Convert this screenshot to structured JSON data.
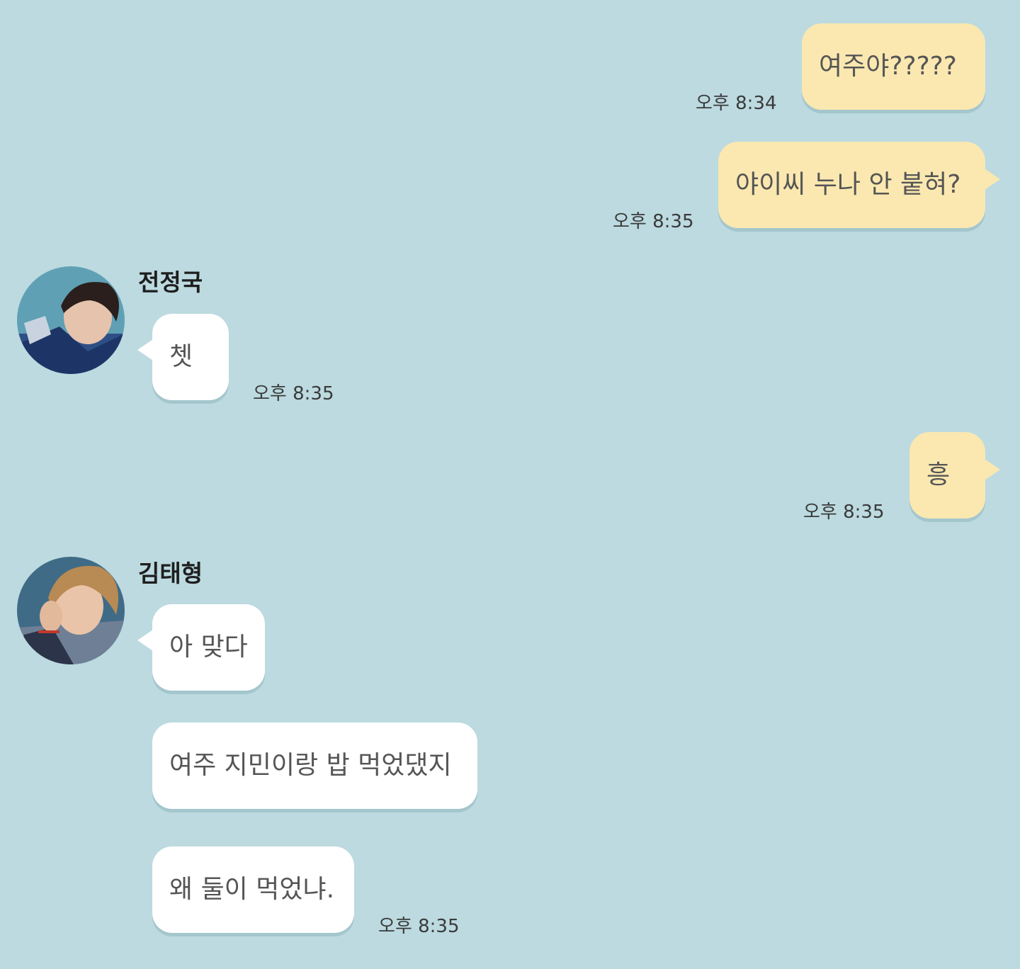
{
  "messages": {
    "m1": {
      "text": "여주야?????",
      "time": "오후 8:34"
    },
    "m2": {
      "text": "야이씨 누나 안 붙혀?",
      "time": "오후 8:35"
    },
    "m3": {
      "sender": "전정국",
      "text": "쳇",
      "time": "오후 8:35"
    },
    "m4": {
      "text": "흥",
      "time": "오후 8:35"
    },
    "m5": {
      "sender": "김태형",
      "lines": [
        "아 맞다",
        "여주 지민이랑 밥 먹었댔지",
        "왜 둘이 먹었냐."
      ],
      "time": "오후 8:35"
    }
  },
  "colors": {
    "background": "#bcdae0",
    "my_bubble": "#fae8b0",
    "their_bubble": "#ffffff"
  }
}
